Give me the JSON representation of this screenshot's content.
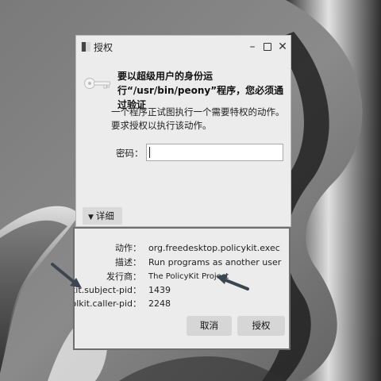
{
  "window": {
    "title": "授权",
    "icon": "app-icon",
    "controls": [
      "minimize",
      "maximize",
      "close"
    ]
  },
  "auth": {
    "heading": "要以超级用户的身份运行“/usr/bin/peony”程序，您必须通过验证",
    "description": "一个程序正试图执行一个需要特权的动作。要求授权以执行该动作。",
    "password_label": "密码：",
    "password_value": ""
  },
  "details": {
    "toggle_label": "详细",
    "rows": [
      {
        "key": "动作：",
        "value": "org.freedesktop.policykit.exec"
      },
      {
        "key": "描述：",
        "value": "Run programs as another user"
      },
      {
        "key": "发行商：",
        "value": "The PolicyKit Project"
      },
      {
        "key": "olkit.subject-pid：",
        "value": "1439"
      },
      {
        "key": "Polkit.caller-pid：",
        "value": "2248"
      }
    ]
  },
  "buttons": {
    "cancel": "取消",
    "authorize": "授权"
  }
}
